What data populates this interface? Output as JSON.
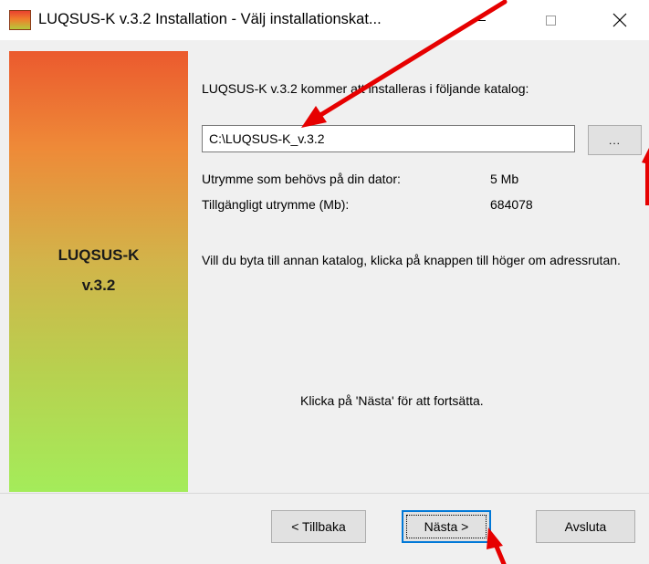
{
  "window": {
    "title": "LUQSUS-K v.3.2 Installation - Välj installationskat..."
  },
  "sidebar": {
    "product_line1": "LUQSUS-K",
    "product_line2": "v.3.2"
  },
  "main": {
    "intro": "LUQSUS-K v.3.2 kommer att installeras i följande katalog:",
    "path_value": "C:\\LUQSUS-K_v.3.2",
    "browse_label": "...",
    "space_needed_label": "Utrymme som behövs på din dator:",
    "space_needed_value": "5 Mb",
    "space_available_label": "Tillgängligt utrymme (Mb):",
    "space_available_value": "684078",
    "change_hint": "Vill du byta till annan katalog, klicka på knappen till höger om adressrutan.",
    "continue_hint": "Klicka på 'Nästa' för att fortsätta."
  },
  "footer": {
    "back_label": "< Tillbaka",
    "next_label": "Nästa >",
    "cancel_label": "Avsluta"
  },
  "colors": {
    "annotation_arrow": "#e60000",
    "focus_border": "#0078d7",
    "gradient_top": "#eb5a2e",
    "gradient_bottom": "#a4ec5a"
  }
}
